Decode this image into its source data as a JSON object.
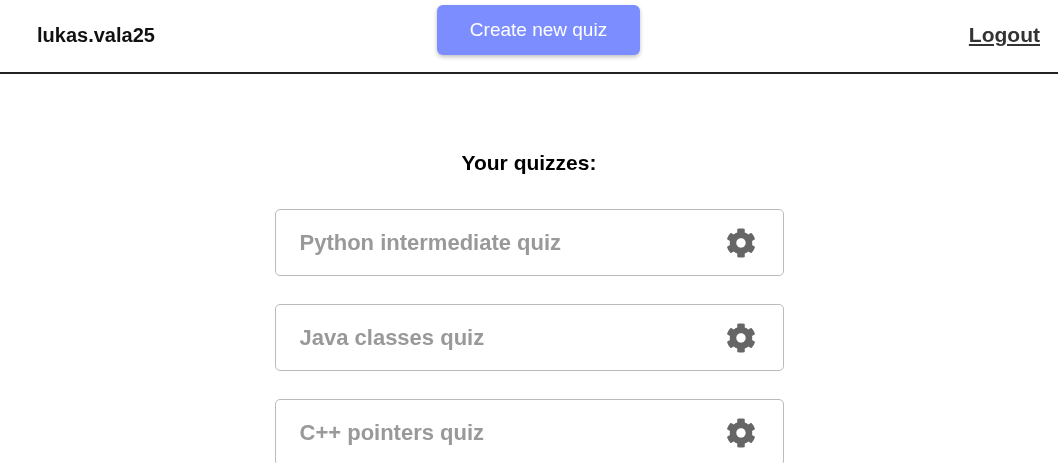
{
  "header": {
    "username": "lukas.vala25",
    "create_button": "Create new quiz",
    "logout_link": "Logout"
  },
  "heading": "Your quizzes:",
  "quizzes": [
    {
      "title": "Python intermediate quiz"
    },
    {
      "title": "Java classes quiz"
    },
    {
      "title": "C++ pointers quiz"
    }
  ]
}
